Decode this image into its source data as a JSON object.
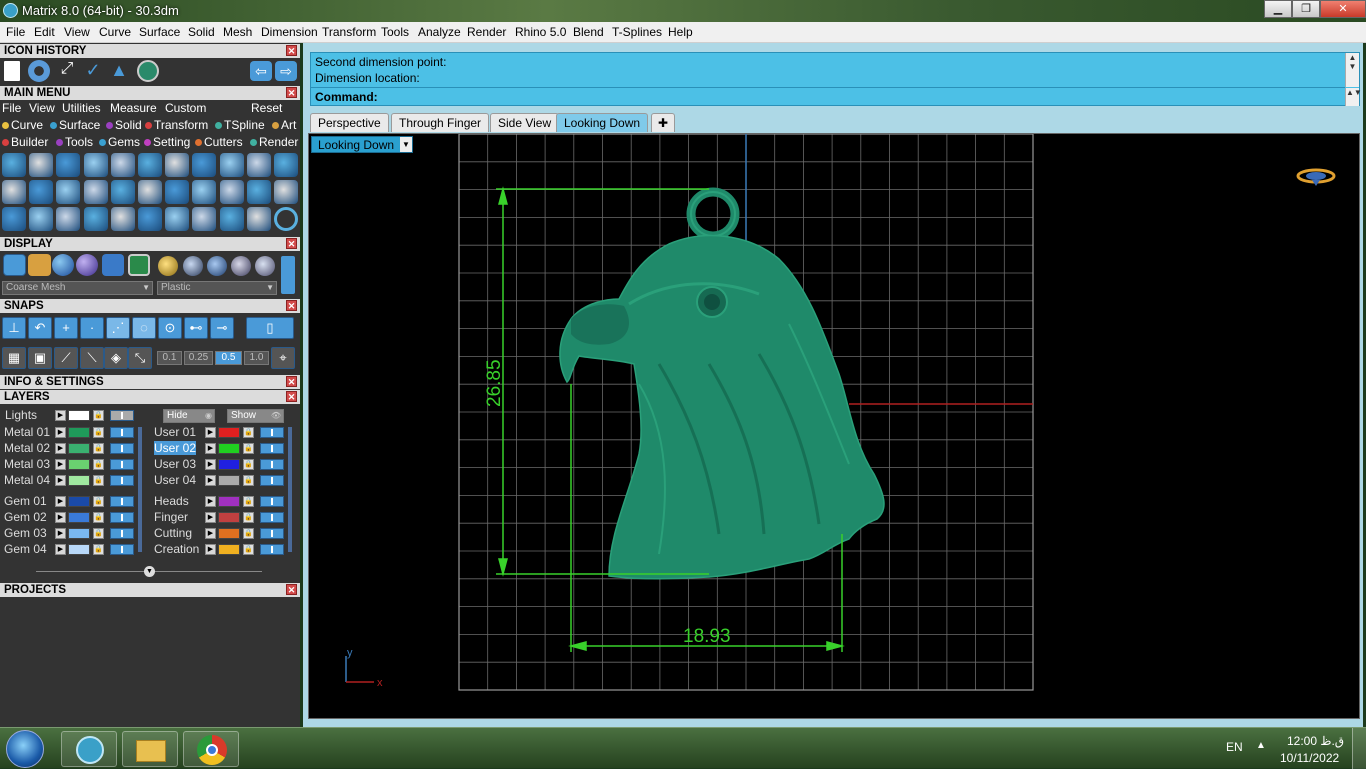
{
  "window": {
    "title": "Matrix 8.0 (64-bit) - 30.3dm",
    "min": "▁",
    "max": "❐",
    "close": "✕"
  },
  "menubar": [
    "File",
    "Edit",
    "View",
    "Curve",
    "Surface",
    "Solid",
    "Mesh",
    "Dimension",
    "Transform",
    "Tools",
    "Analyze",
    "Render",
    "Rhino 5.0",
    "Blend",
    "T-Splines",
    "Help"
  ],
  "left": {
    "icon_history": "ICON HISTORY",
    "main_menu": "MAIN MENU",
    "mm_row1": [
      "File",
      "View",
      "Utilities",
      "Measure",
      "Custom",
      "Reset"
    ],
    "mm_row2": [
      "Curve",
      "Surface",
      "Solid",
      "Transform",
      "TSpline",
      "Art"
    ],
    "mm_row3": [
      "Builder",
      "Tools",
      "Gems",
      "Setting",
      "Cutters",
      "Render"
    ],
    "display": "DISPLAY",
    "display_dd1": "Coarse Mesh",
    "display_dd2": "Plastic",
    "snaps": "SNAPS",
    "snap_values": [
      "0.1",
      "0.25",
      "0.5",
      "1.0"
    ],
    "info_settings": "INFO & SETTINGS",
    "layers": "LAYERS",
    "lights": "Lights",
    "hide": "Hide",
    "show": "Show",
    "layers_left": [
      "Metal 01",
      "Metal 02",
      "Metal 03",
      "Metal 04",
      "Gem 01",
      "Gem 02",
      "Gem 03",
      "Gem 04"
    ],
    "layers_right": [
      "User 01",
      "User 02",
      "User 03",
      "User 04",
      "Heads",
      "Finger",
      "Cutting",
      "Creation"
    ],
    "projects": "PROJECTS"
  },
  "command": {
    "line1": "Second dimension point:",
    "line2": "Dimension location:",
    "prompt": "Command:"
  },
  "tabs": [
    "Perspective",
    "Through Finger",
    "Side View",
    "Looking Down"
  ],
  "active_tab": "Looking Down",
  "viewport": {
    "view_dropdown": "Looking Down",
    "dim_vertical": "26.85",
    "dim_horizontal": "18.93",
    "axis_y": "y",
    "axis_x": "x"
  },
  "tray": {
    "lang": "EN",
    "time": "12:00 ق.ظ",
    "date": "10/11/2022"
  },
  "colors": {
    "accent": "#4cc0e6",
    "model": "#1f8a6a",
    "dimension": "#39d12b",
    "grid": "#7a7a7a"
  }
}
